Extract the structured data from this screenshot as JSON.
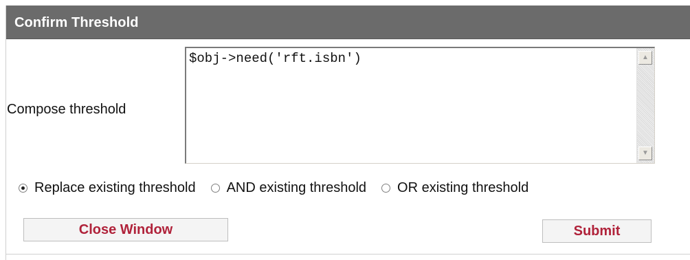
{
  "header": {
    "title": "Confirm Threshold"
  },
  "form": {
    "compose_label": "Compose threshold",
    "threshold_text": "$obj->need('rft.isbn')",
    "options": [
      {
        "label": "Replace existing threshold",
        "selected": true
      },
      {
        "label": "AND existing threshold",
        "selected": false
      },
      {
        "label": "OR existing threshold",
        "selected": false
      }
    ]
  },
  "actions": {
    "close_label": "Close Window",
    "submit_label": "Submit"
  },
  "colors": {
    "titlebar": "#6b6b6b",
    "button_text": "#b0223a"
  },
  "icons": {
    "scroll_up": "scroll-up-arrow-icon",
    "scroll_down": "scroll-down-arrow-icon"
  }
}
